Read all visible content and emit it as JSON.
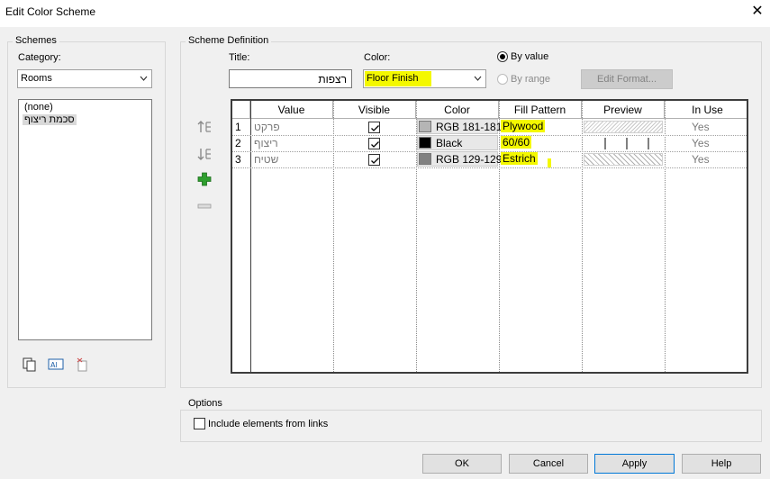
{
  "window": {
    "title": "Edit Color Scheme"
  },
  "schemes": {
    "legend": "Schemes",
    "category_label": "Category:",
    "category_value": "Rooms",
    "items": [
      "(none)",
      "סכמת ריצוף"
    ]
  },
  "definition": {
    "legend": "Scheme Definition",
    "title_label": "Title:",
    "title_value": "רצפות",
    "color_label": "Color:",
    "color_value": "Floor Finish",
    "by_value_label": "By value",
    "by_range_label": "By range",
    "edit_format_label": "Edit Format..."
  },
  "table": {
    "columns": [
      "Value",
      "Visible",
      "Color",
      "Fill Pattern",
      "Preview",
      "In Use"
    ],
    "rows": [
      {
        "num": "1",
        "value": "פרקט",
        "color_name": "RGB 181-181",
        "swatch": "#b5b5b5",
        "fill": "Plywood",
        "in_use": "Yes"
      },
      {
        "num": "2",
        "value": "ריצוף",
        "color_name": "Black",
        "swatch": "#000000",
        "fill": "60/60",
        "in_use": "Yes"
      },
      {
        "num": "3",
        "value": "שטיח",
        "color_name": "RGB 129-129",
        "swatch": "#818181",
        "fill": "Estrich",
        "in_use": "Yes"
      }
    ]
  },
  "options": {
    "legend": "Options",
    "include_links_label": "Include elements from links"
  },
  "buttons": {
    "ok": "OK",
    "cancel": "Cancel",
    "apply": "Apply",
    "help": "Help"
  },
  "colors": {
    "highlight": "#f4f800",
    "window_bg": "#f0f0f0",
    "add_green": "#2e9e2e"
  }
}
